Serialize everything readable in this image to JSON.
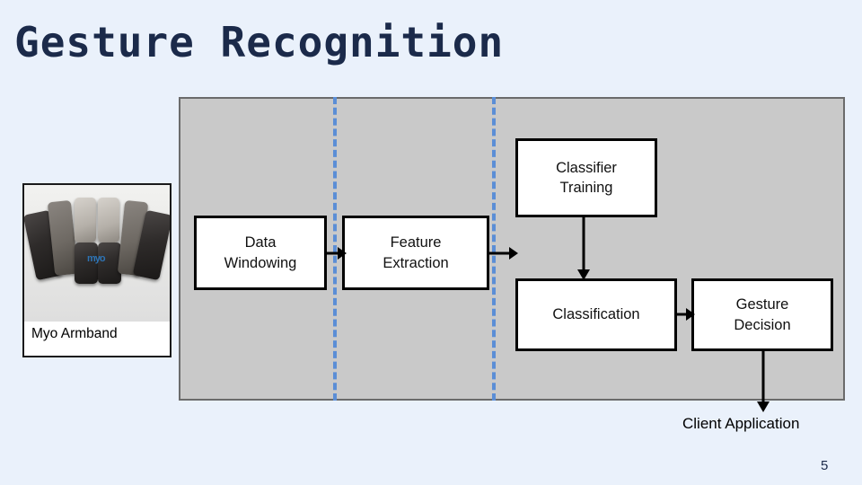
{
  "slide": {
    "title": "Gesture Recognition",
    "page_number": "5"
  },
  "armband": {
    "label": "Myo Armband",
    "logo_text": "myo"
  },
  "pipeline": {
    "boxes": [
      {
        "id": "data-windowing",
        "label": "Data\nWindowing",
        "line1": "Data",
        "line2": "Windowing"
      },
      {
        "id": "feature-extraction",
        "label": "Feature\nExtraction",
        "line1": "Feature",
        "line2": "Extraction"
      },
      {
        "id": "classifier-training",
        "label": "Classifier\nTraining",
        "line1": "Classifier",
        "line2": "Training"
      },
      {
        "id": "classification",
        "label": "Classification",
        "line1": "Classification",
        "line2": ""
      },
      {
        "id": "gesture-decision",
        "label": "Gesture\nDecision",
        "line1": "Gesture",
        "line2": "Decision"
      }
    ],
    "client_application": "Client Application"
  },
  "colors": {
    "background": "#eaf1fb",
    "panel_fill": "#c9c9c9",
    "panel_border": "#6b6b6b",
    "divider": "#5b8ed6",
    "box_border": "#000000",
    "box_fill": "#ffffff",
    "title_color": "#1b2a4a"
  }
}
